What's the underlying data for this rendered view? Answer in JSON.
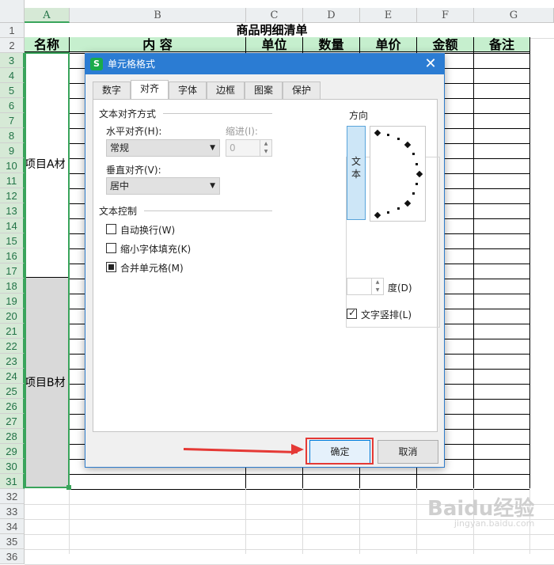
{
  "sheet": {
    "columns": [
      "A",
      "B",
      "C",
      "D",
      "E",
      "F",
      "G"
    ],
    "rows": [
      "1",
      "2",
      "3",
      "4",
      "5",
      "6",
      "7",
      "8",
      "9",
      "10",
      "11",
      "12",
      "13",
      "14",
      "15",
      "16",
      "17",
      "18",
      "19",
      "20",
      "21",
      "22",
      "23",
      "24",
      "25",
      "26",
      "27",
      "28",
      "29",
      "30",
      "31",
      "32",
      "33",
      "34",
      "35",
      "36"
    ],
    "title": "商品明细清单",
    "headers": [
      "名称",
      "内 容",
      "单位",
      "数量",
      "单价",
      "金额",
      "备注"
    ],
    "item_a": "项目A材",
    "item_b": "项目B材"
  },
  "dialog": {
    "title": "单元格格式",
    "app_icon": "S",
    "close_icon": "close-icon",
    "tabs": [
      "数字",
      "对齐",
      "字体",
      "边框",
      "图案",
      "保护"
    ],
    "active_tab": "对齐",
    "text_alignment_section": "文本对齐方式",
    "horizontal_label": "水平对齐(H):",
    "horizontal_value": "常规",
    "indent_label": "缩进(I):",
    "indent_value": "0",
    "vertical_label": "垂直对齐(V):",
    "vertical_value": "居中",
    "text_control_section": "文本控制",
    "wrap_text": {
      "label": "自动换行(W)",
      "checked": false
    },
    "shrink_to_fit": {
      "label": "缩小字体填充(K)",
      "checked": false
    },
    "merge_cells": {
      "label": "合并单元格(M)",
      "checked": true
    },
    "orientation_section": "方向",
    "vertical_text_button": "文本",
    "degree_value": "",
    "degree_label": "度(D)",
    "stacked_text": {
      "label": "文字竖排(L)",
      "checked": true
    },
    "ok_label": "确定",
    "cancel_label": "取消"
  },
  "watermark": {
    "brand": "Baidu经验",
    "url": "jingyan.baidu.com"
  },
  "colors": {
    "accent": "#2b7cd3",
    "header_fill": "#c6efce",
    "highlight": "#e53935",
    "selection": "#39a45b"
  }
}
